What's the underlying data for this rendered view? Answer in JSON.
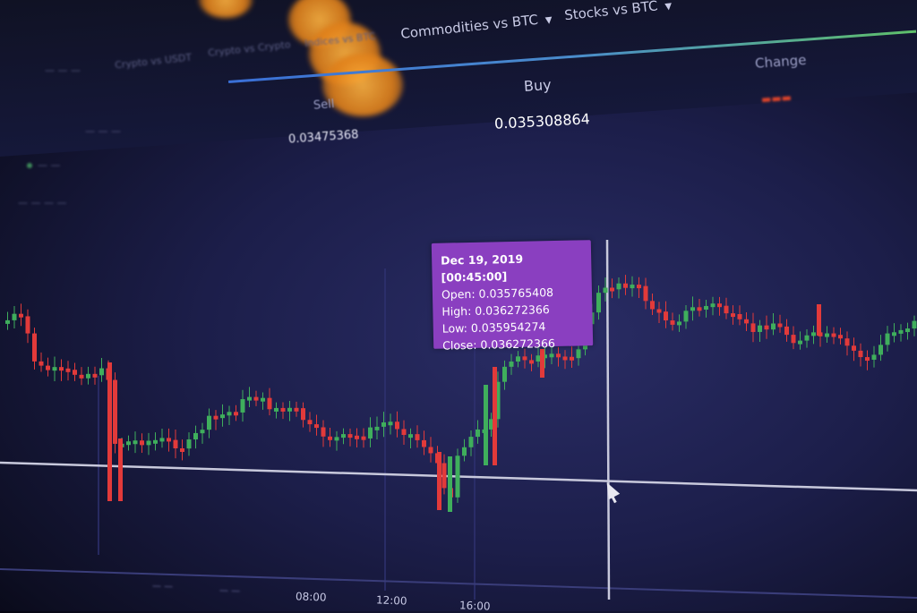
{
  "tabs": {
    "items": [
      {
        "label": "Commodities vs BTC",
        "dropdown": true
      },
      {
        "label": "Stocks vs BTC",
        "dropdown": true
      },
      {
        "label": "Indices vs BTC",
        "dropdown": false
      },
      {
        "label": "Crypto vs Crypto",
        "dropdown": false
      },
      {
        "label": "Crypto vs USDT",
        "dropdown": false
      }
    ]
  },
  "trade": {
    "buy_label": "Buy",
    "sell_label": "Sell",
    "change_label": "Change",
    "buy_price": "0.035308864",
    "sell_price": "0.03475368"
  },
  "tooltip": {
    "date": "Dec 19, 2019 [00:45:00]",
    "open": "Open: 0.035765408",
    "high": "High: 0.036272366",
    "low": "Low: 0.035954274",
    "close": "Close: 0.036272366"
  },
  "axis": {
    "times": [
      "08:00",
      "12:00",
      "16:00"
    ]
  },
  "colors": {
    "up": "#3fae5c",
    "down": "#e23a3a",
    "tooltip_bg": "#8a3fc0",
    "crosshair": "#c8c9dc",
    "background": "#1c1e4a"
  },
  "chart_data": {
    "type": "candlestick",
    "title": "",
    "hovered": {
      "date": "Dec 19, 2019 [00:45:00]",
      "open": 0.035765408,
      "high": 0.036272366,
      "low": 0.035954274,
      "close": 0.036272366
    }
  }
}
